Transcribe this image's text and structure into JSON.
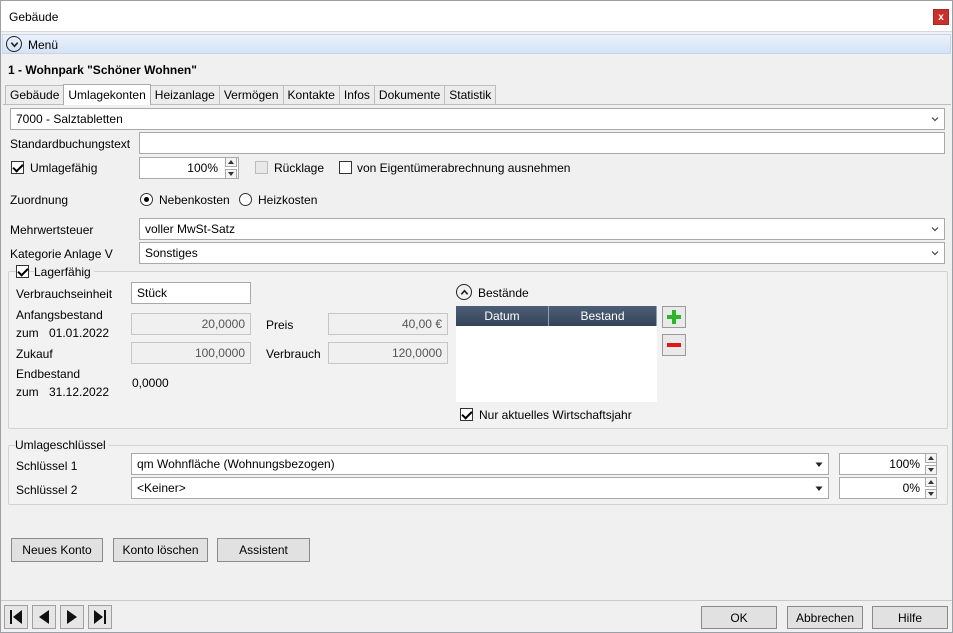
{
  "window": {
    "title": "Gebäude",
    "close_label": "x"
  },
  "menu": {
    "label": "Menü"
  },
  "heading": "1 - Wohnpark \"Schöner Wohnen\"",
  "tabs": [
    "Gebäude",
    "Umlagekonten",
    "Heizanlage",
    "Vermögen",
    "Kontakte",
    "Infos",
    "Dokumente",
    "Statistik"
  ],
  "active_tab": "Umlagekonten",
  "konto": {
    "selected": "7000 - Salztabletten"
  },
  "standardbuchungstext": {
    "label": "Standardbuchungstext",
    "value": ""
  },
  "umlagefaehig": {
    "label": "Umlagefähig",
    "checked": true,
    "percent": "100%"
  },
  "ruecklage": {
    "label": "Rücklage",
    "checked": false
  },
  "eigentuemer": {
    "label": "von Eigentümerabrechnung ausnehmen",
    "checked": false
  },
  "zuordnung": {
    "label": "Zuordnung",
    "options": [
      "Nebenkosten",
      "Heizkosten"
    ],
    "selected": "Nebenkosten"
  },
  "mehrwertsteuer": {
    "label": "Mehrwertsteuer",
    "selected": "voller MwSt-Satz"
  },
  "kategorie": {
    "label": "Kategorie Anlage V",
    "selected": "Sonstiges"
  },
  "lager": {
    "label": "Lagerfähig",
    "checked": true,
    "verbrauchseinheit_label": "Verbrauchseinheit",
    "verbrauchseinheit": "Stück",
    "anfangsbestand_label": "Anfangsbestand",
    "anfangsbestand_zum": "zum",
    "anfangsbestand_date": "01.01.2022",
    "anfangsbestand": "20,0000",
    "preis_label": "Preis",
    "preis": "40,00 €",
    "zukauf_label": "Zukauf",
    "zukauf": "100,0000",
    "verbrauch_label": "Verbrauch",
    "verbrauch": "120,0000",
    "endbestand_label": "Endbestand",
    "endbestand_zum": "zum",
    "endbestand_date": "31.12.2022",
    "endbestand": "0,0000"
  },
  "bestaende": {
    "label": "Bestände",
    "columns": [
      "Datum",
      "Bestand"
    ],
    "nur_aktuell_label": "Nur aktuelles Wirtschaftsjahr",
    "nur_aktuell_checked": true
  },
  "umlageschluessel": {
    "label": "Umlageschlüssel",
    "schluessel1_label": "Schlüssel 1",
    "schluessel1": "qm Wohnfläche (Wohnungsbezogen)",
    "schluessel1_percent": "100%",
    "schluessel2_label": "Schlüssel 2",
    "schluessel2": "<Keiner>",
    "schluessel2_percent": "0%"
  },
  "actions": {
    "new": "Neues Konto",
    "delete": "Konto löschen",
    "assistant": "Assistent"
  },
  "footer": {
    "ok": "OK",
    "cancel": "Abbrechen",
    "help": "Hilfe"
  },
  "colors": {
    "add": "#2bb52b",
    "remove": "#e01515",
    "grid_header": "#3e4f66",
    "menubar": "#dbe7f7",
    "close": "#c9302c"
  }
}
